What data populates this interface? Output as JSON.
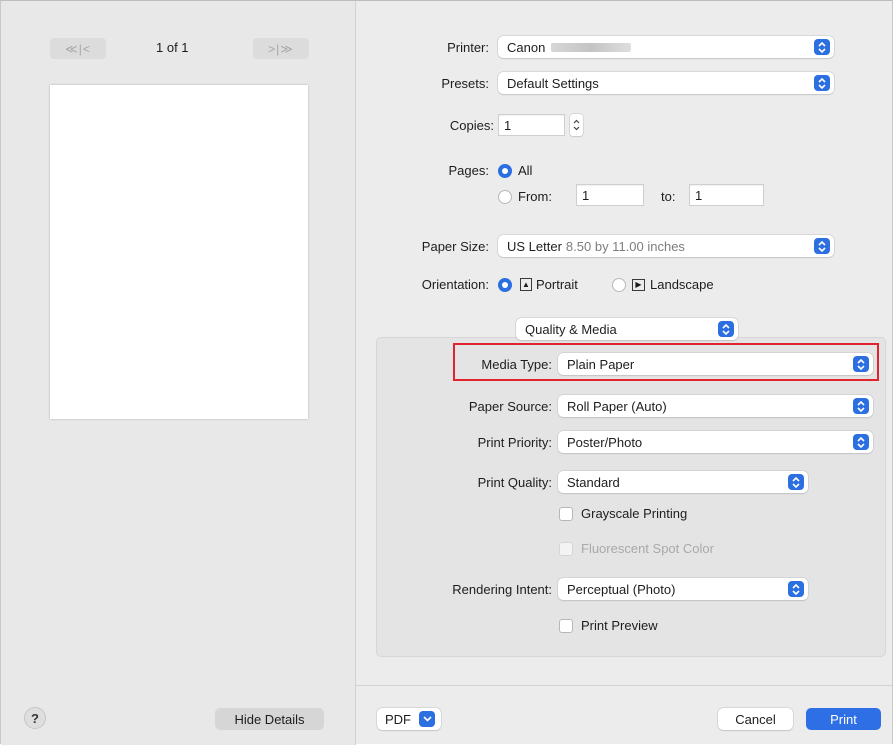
{
  "preview": {
    "first_prev_label": "≪|<",
    "next_last_label": ">|≫",
    "page_indicator": "1 of 1",
    "help_label": "?",
    "hide_details_label": "Hide Details"
  },
  "printer": {
    "label": "Printer:",
    "value": "Canon"
  },
  "presets": {
    "label": "Presets:",
    "value": "Default Settings"
  },
  "copies": {
    "label": "Copies:",
    "value": "1"
  },
  "pages": {
    "label": "Pages:",
    "all_label": "All",
    "from_label": "From:",
    "from_value": "1",
    "to_label": "to:",
    "to_value": "1"
  },
  "paper_size": {
    "label": "Paper Size:",
    "value": "US Letter",
    "detail": "8.50 by 11.00 inches"
  },
  "orientation": {
    "label": "Orientation:",
    "portrait_label": "Portrait",
    "landscape_label": "Landscape"
  },
  "section": {
    "value": "Quality & Media"
  },
  "media_type": {
    "label": "Media Type:",
    "value": "Plain Paper"
  },
  "paper_source": {
    "label": "Paper Source:",
    "value": "Roll Paper (Auto)"
  },
  "print_priority": {
    "label": "Print Priority:",
    "value": "Poster/Photo"
  },
  "print_quality": {
    "label": "Print Quality:",
    "value": "Standard"
  },
  "grayscale": {
    "label": "Grayscale Printing"
  },
  "fluorescent": {
    "label": "Fluorescent Spot Color"
  },
  "rendering_intent": {
    "label": "Rendering Intent:",
    "value": "Perceptual (Photo)"
  },
  "print_preview": {
    "label": "Print Preview"
  },
  "footer": {
    "pdf_label": "PDF",
    "cancel_label": "Cancel",
    "print_label": "Print"
  },
  "colors": {
    "accent": "#2c6fe0",
    "highlight": "#e0232c"
  }
}
